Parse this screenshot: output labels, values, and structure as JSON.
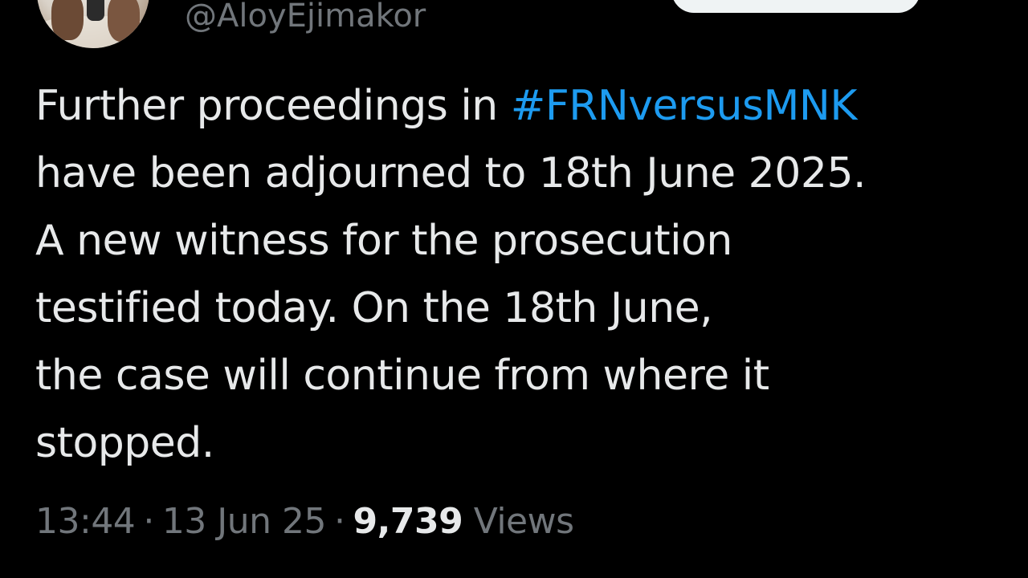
{
  "author": {
    "handle": "@AloyEjimakor"
  },
  "tweet": {
    "lines": [
      {
        "before": "Further proceedings in ",
        "hashtag": "#FRNversusMNK"
      },
      {
        "text": "have been adjourned to 18th June 2025."
      },
      {
        "text": "A new witness for the prosecution"
      },
      {
        "text": "testified today. On the 18th June,"
      },
      {
        "text": "the case will continue from where it"
      },
      {
        "text": "stopped."
      }
    ]
  },
  "meta": {
    "time": "13:44",
    "date": "13 Jun 25",
    "separator": "·",
    "views_count": "9,739",
    "views_label": "Views"
  },
  "colors": {
    "background": "#000000",
    "text": "#e7e9ea",
    "secondary": "#71767b",
    "hashtag": "#1d9bf0"
  }
}
